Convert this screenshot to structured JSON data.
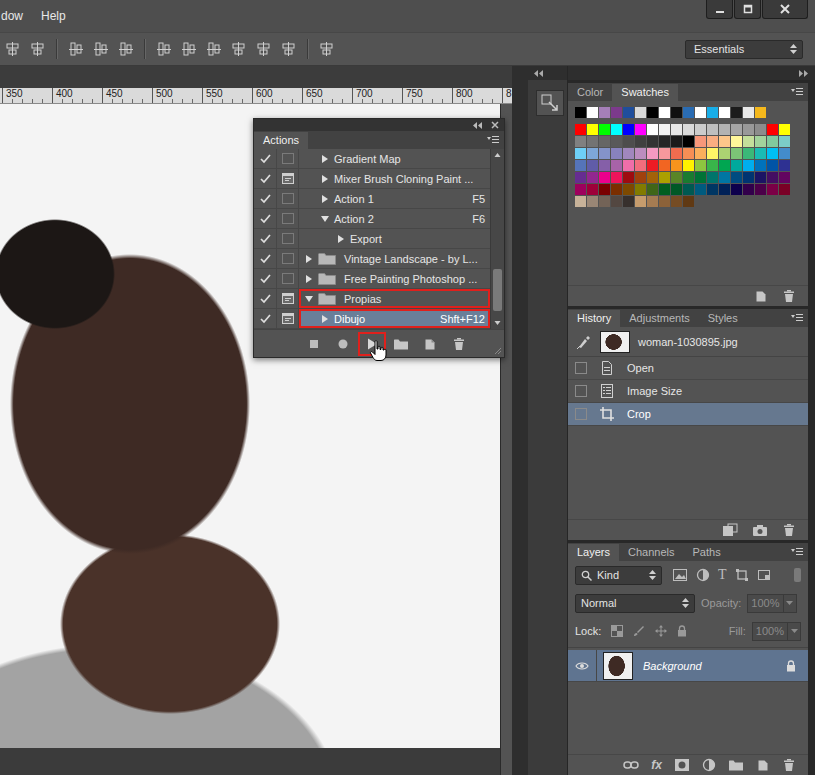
{
  "menu": [
    "dow",
    "Help"
  ],
  "workspace": {
    "label": "Essentials"
  },
  "ruler": {
    "ticks": [
      "350",
      "400",
      "450",
      "500",
      "550",
      "600",
      "650",
      "700",
      "750",
      "800",
      "8"
    ]
  },
  "actions_panel": {
    "tabs": [
      {
        "label": "Actions",
        "selected": true
      }
    ],
    "rows": [
      {
        "label": "Gradient Map",
        "kind": "action",
        "level": 1,
        "enabled": true,
        "dialog": false,
        "expanded": false,
        "selected": false,
        "highlighted": false
      },
      {
        "label": "Mixer Brush Cloning Paint ...",
        "kind": "action",
        "level": 1,
        "enabled": true,
        "dialog": true,
        "expanded": false,
        "selected": false,
        "highlighted": false
      },
      {
        "label": "Action 1",
        "shortcut": "F5",
        "kind": "action",
        "level": 1,
        "enabled": true,
        "dialog": false,
        "expanded": false,
        "selected": false,
        "highlighted": false
      },
      {
        "label": "Action 2",
        "shortcut": "F6",
        "kind": "action",
        "level": 1,
        "enabled": true,
        "dialog": false,
        "expanded": true,
        "selected": false,
        "highlighted": false
      },
      {
        "label": "Export",
        "kind": "command",
        "level": 2,
        "enabled": true,
        "dialog": false,
        "expanded": false,
        "selected": false,
        "highlighted": false
      },
      {
        "label": "Vintage Landscape - by L...",
        "kind": "set",
        "level": 0,
        "enabled": true,
        "dialog": false,
        "expanded": false,
        "selected": false,
        "highlighted": false
      },
      {
        "label": "Free Painting Photoshop ...",
        "kind": "set",
        "level": 0,
        "enabled": true,
        "dialog": false,
        "expanded": false,
        "selected": false,
        "highlighted": false
      },
      {
        "label": "Propias",
        "kind": "set",
        "level": 0,
        "enabled": true,
        "dialog": true,
        "expanded": true,
        "selected": false,
        "highlighted": true
      },
      {
        "label": "Dibujo",
        "shortcut": "Shft+F12",
        "kind": "action",
        "level": 1,
        "enabled": true,
        "dialog": true,
        "expanded": false,
        "selected": true,
        "highlighted": true
      }
    ],
    "toolbar": [
      {
        "kind": "stop",
        "highlighted": false
      },
      {
        "kind": "record",
        "highlighted": false
      },
      {
        "kind": "play",
        "highlighted": true
      },
      {
        "kind": "new-set",
        "highlighted": false
      },
      {
        "kind": "new-action",
        "highlighted": false
      },
      {
        "kind": "delete",
        "highlighted": false
      }
    ]
  },
  "swatches_panel": {
    "tabs": [
      {
        "label": "Color",
        "selected": false
      },
      {
        "label": "Swatches",
        "selected": true
      }
    ],
    "recent": [
      {
        "color": "#000000"
      },
      {
        "color": "#ffffff"
      },
      {
        "color": "#a57fb8"
      },
      {
        "color": "#7c3a8c"
      },
      {
        "color": "#1f4e9c"
      },
      {
        "color": "#d9d9d9"
      },
      {
        "color": "#000000"
      },
      {
        "color": "#ffffff"
      },
      {
        "color": "#101010"
      },
      {
        "color": "#2a6cb3"
      },
      {
        "color": "#ffffff"
      },
      {
        "color": "#19aee8"
      },
      {
        "color": "#ffffff"
      },
      {
        "color": "#1c1c1c"
      },
      {
        "color": "#e8e8e8"
      },
      {
        "color": "#f5b81c"
      }
    ],
    "swatches": [
      {
        "color": "#ff0000"
      },
      {
        "color": "#ffff00"
      },
      {
        "color": "#00ff00"
      },
      {
        "color": "#00ffff"
      },
      {
        "color": "#0000ff"
      },
      {
        "color": "#ff00ff"
      },
      {
        "color": "#ffffff"
      },
      {
        "color": "#f2f2f2"
      },
      {
        "color": "#e6e6e6"
      },
      {
        "color": "#d9d9d9"
      },
      {
        "color": "#cccccc"
      },
      {
        "color": "#bfbfbf"
      },
      {
        "color": "#b3b3b3"
      },
      {
        "color": "#a6a6a6"
      },
      {
        "color": "#999999"
      },
      {
        "color": "#8c8c8c"
      },
      {
        "color": "#ff0000"
      },
      {
        "color": "#ffff00"
      },
      {
        "color": "#808080"
      },
      {
        "color": "#737373"
      },
      {
        "color": "#666666"
      },
      {
        "color": "#595959"
      },
      {
        "color": "#4d4d4d"
      },
      {
        "color": "#404040"
      },
      {
        "color": "#333333"
      },
      {
        "color": "#262626"
      },
      {
        "color": "#1a1a1a"
      },
      {
        "color": "#000000"
      },
      {
        "color": "#f7977a"
      },
      {
        "color": "#f9ad81"
      },
      {
        "color": "#fdc68a"
      },
      {
        "color": "#fff79a"
      },
      {
        "color": "#c4df9b"
      },
      {
        "color": "#a2d39c"
      },
      {
        "color": "#82ca9d"
      },
      {
        "color": "#7bcdc8"
      },
      {
        "color": "#6ecff6"
      },
      {
        "color": "#7ea7d8"
      },
      {
        "color": "#8493ca"
      },
      {
        "color": "#8882be"
      },
      {
        "color": "#a187be"
      },
      {
        "color": "#bc8dbf"
      },
      {
        "color": "#f49ac2"
      },
      {
        "color": "#f6989d"
      },
      {
        "color": "#f26c4f"
      },
      {
        "color": "#f68e55"
      },
      {
        "color": "#fbaf5c"
      },
      {
        "color": "#fff467"
      },
      {
        "color": "#acd372"
      },
      {
        "color": "#7cc576"
      },
      {
        "color": "#3bb878"
      },
      {
        "color": "#1abbb4"
      },
      {
        "color": "#00bff3"
      },
      {
        "color": "#438ccb"
      },
      {
        "color": "#5574b9"
      },
      {
        "color": "#605ca8"
      },
      {
        "color": "#855fa8"
      },
      {
        "color": "#a763a8"
      },
      {
        "color": "#f06ea9"
      },
      {
        "color": "#f26d7d"
      },
      {
        "color": "#ed1c24"
      },
      {
        "color": "#f26522"
      },
      {
        "color": "#f7941d"
      },
      {
        "color": "#fff200"
      },
      {
        "color": "#8dc63f"
      },
      {
        "color": "#39b54a"
      },
      {
        "color": "#00a651"
      },
      {
        "color": "#00a99d"
      },
      {
        "color": "#00aeef"
      },
      {
        "color": "#0072bc"
      },
      {
        "color": "#0054a6"
      },
      {
        "color": "#2e3192"
      },
      {
        "color": "#662d91"
      },
      {
        "color": "#92278f"
      },
      {
        "color": "#ec008c"
      },
      {
        "color": "#ed145b"
      },
      {
        "color": "#9e0b0f"
      },
      {
        "color": "#a0410d"
      },
      {
        "color": "#a36209"
      },
      {
        "color": "#aba000"
      },
      {
        "color": "#598527"
      },
      {
        "color": "#1a7b30"
      },
      {
        "color": "#007236"
      },
      {
        "color": "#00746b"
      },
      {
        "color": "#0076a3"
      },
      {
        "color": "#004b80"
      },
      {
        "color": "#003471"
      },
      {
        "color": "#1b1464"
      },
      {
        "color": "#440e62"
      },
      {
        "color": "#630460"
      },
      {
        "color": "#9e005d"
      },
      {
        "color": "#9e0039"
      },
      {
        "color": "#790000"
      },
      {
        "color": "#7b2e00"
      },
      {
        "color": "#7d4900"
      },
      {
        "color": "#827b00"
      },
      {
        "color": "#406618"
      },
      {
        "color": "#005e20"
      },
      {
        "color": "#005826"
      },
      {
        "color": "#005952"
      },
      {
        "color": "#005b7f"
      },
      {
        "color": "#003663"
      },
      {
        "color": "#002157"
      },
      {
        "color": "#0d004c"
      },
      {
        "color": "#32004b"
      },
      {
        "color": "#4b0049"
      },
      {
        "color": "#7b0046"
      },
      {
        "color": "#7a0026"
      },
      {
        "color": "#c7b299"
      },
      {
        "color": "#998675"
      },
      {
        "color": "#736357"
      },
      {
        "color": "#534741"
      },
      {
        "color": "#37302d"
      },
      {
        "color": "#c69c6d"
      },
      {
        "color": "#a67c52"
      },
      {
        "color": "#8c6239"
      },
      {
        "color": "#754c24"
      },
      {
        "color": "#603913"
      }
    ]
  },
  "history_panel": {
    "tabs": [
      {
        "label": "History",
        "selected": true
      },
      {
        "label": "Adjustments",
        "selected": false
      },
      {
        "label": "Styles",
        "selected": false
      }
    ],
    "snapshot": {
      "label": "woman-1030895.jpg"
    },
    "steps": [
      {
        "label": "Open",
        "kind": "document",
        "selected": false
      },
      {
        "label": "Image Size",
        "kind": "command",
        "selected": false
      },
      {
        "label": "Crop",
        "kind": "crop",
        "selected": true
      }
    ]
  },
  "layers_panel": {
    "tabs": [
      {
        "label": "Layers",
        "selected": true
      },
      {
        "label": "Channels",
        "selected": false
      },
      {
        "label": "Paths",
        "selected": false
      }
    ],
    "filter": {
      "label": "Kind"
    },
    "type_filter": {
      "label": "T"
    },
    "blend_mode": {
      "label": "Normal"
    },
    "opacity": {
      "label": "Opacity:",
      "value": "100%",
      "disabled": true
    },
    "lock": {
      "label": "Lock:"
    },
    "fill": {
      "label": "Fill:",
      "value": "100%",
      "disabled": true
    },
    "layers": [
      {
        "name": "Background",
        "visible": true,
        "locked": true,
        "selected": true
      }
    ],
    "effects_button": {
      "label": "fx"
    }
  }
}
